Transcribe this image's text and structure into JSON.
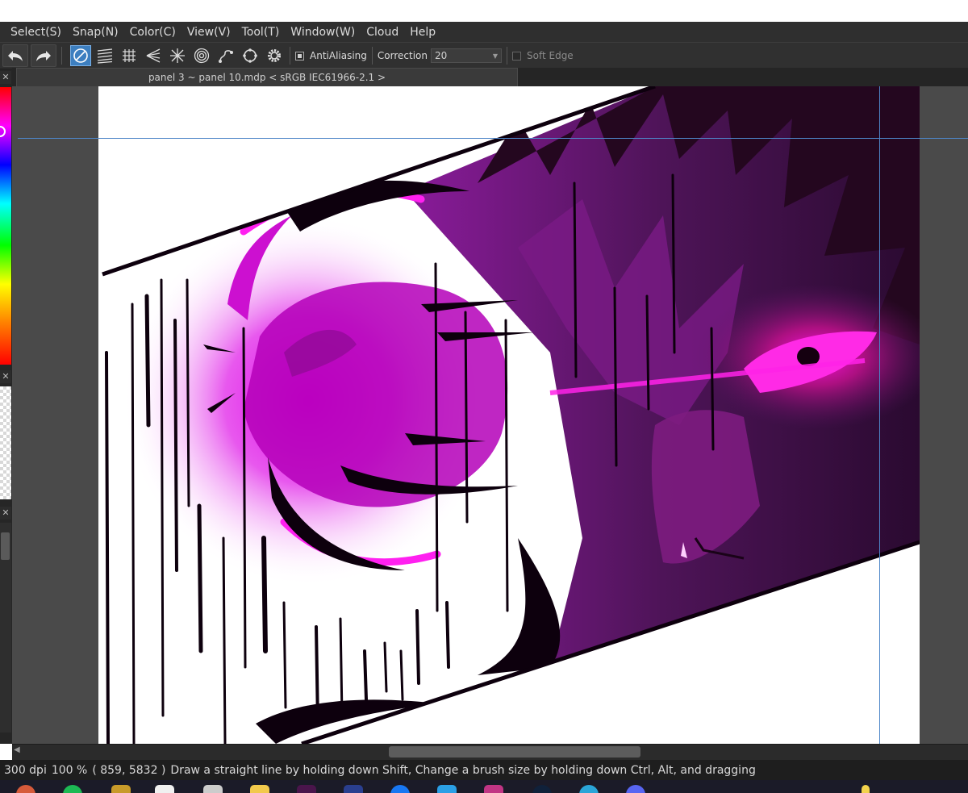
{
  "menu": {
    "items": [
      "Select(S)",
      "Snap(N)",
      "Color(C)",
      "View(V)",
      "Tool(T)",
      "Window(W)",
      "Cloud",
      "Help"
    ]
  },
  "toolbar": {
    "undo_icon": "undo-icon",
    "redo_icon": "redo-icon",
    "snap_tools": [
      "snap-off-icon",
      "parallel-lines-icon",
      "crosshatch-icon",
      "vanishing-point-icon",
      "radial-lines-icon",
      "concentric-circle-icon",
      "curve-icon",
      "circle-icon",
      "settings-icon"
    ],
    "antialiasing_label": "AntiAliasing",
    "antialiasing_checked": true,
    "correction_label": "Correction",
    "correction_value": "20",
    "soft_edge_label": "Soft Edge",
    "soft_edge_checked": false
  },
  "document": {
    "tab_title": "panel 3 ~ panel 10.mdp < sRGB IEC61966-2.1 >"
  },
  "status": {
    "dpi": "300 dpi",
    "zoom": "100 %",
    "coords": "( 859, 5832 )",
    "hint": "Draw a straight line by holding down Shift, Change a brush size by holding down Ctrl, Alt, and dragging"
  },
  "colors": {
    "accent": "#3d7fc0",
    "art_magenta": "#e000e0",
    "art_purple": "#6a1a6e"
  }
}
